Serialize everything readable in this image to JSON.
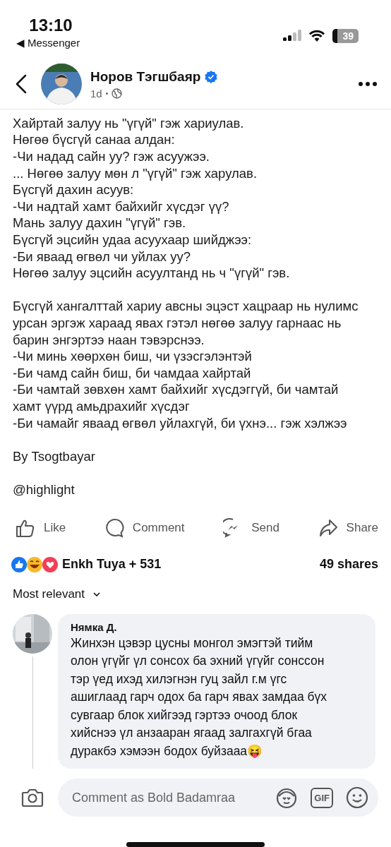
{
  "status_bar": {
    "time": "13:10",
    "back_app": "◀ Messenger",
    "battery": "39"
  },
  "post": {
    "author": "Норов Тэгшбаяр",
    "verified": true,
    "time": "1d",
    "paragraphs": [
      [
        "Хайртай залуу нь \"үгүй\" гэж хариулав.",
        "Нөгөө бүсгүй санаа алдан:",
        "-Чи надад сайн уу? гэж асуужээ.",
        "... Нөгөө залуу мөн л \"үгүй\" гэж харулав.",
        "Бүсгүй дахин асуув:",
        "-Чи надтай хамт байхийг хүсдэг үү?",
        "Мань залуу дахин \"үгүй\" гэв.",
        "Бүсгүй эцсийн удаа асуухаар шийджээ:",
        "-Би яваад өгвөл чи уйлах уу?",
        "Нөгөө залуу эцсийн асуултанд нь ч \"үгүй\" гэв."
      ],
      [
        "Бүсгүй хангалттай хариу авсны эцэст хацраар нь нулимс",
        "урсан эргэж хараад явах гэтэл нөгөө залуу гарнаас нь",
        "барин энгэртээ наан тэвэрснээ.",
        "-Чи минь хөөрхөн биш, чи үзэсгэлэнтэй",
        "-Би чамд сайн биш, би чамдаа хайртай",
        "-Би чамтай зөвхөн хамт байхийг хүсдэггүй, би чамтай",
        "хамт үүрд амьдрахийг хүсдэг",
        "-Би чамайг яваад өгвөл уйлахгүй, би үхнэ... гэж хэлжээ"
      ],
      [
        "By Tsogtbayar"
      ],
      [
        "@highlight"
      ]
    ]
  },
  "actions": [
    {
      "kind": "like",
      "label": "Like"
    },
    {
      "kind": "comment",
      "label": "Comment"
    },
    {
      "kind": "send",
      "label": "Send"
    },
    {
      "kind": "share",
      "label": "Share"
    }
  ],
  "reactions": {
    "summary": "Enkh Tuya + 531",
    "shares": "49 shares"
  },
  "sort": "Most relevant",
  "comment": {
    "author": "Нямка Д.",
    "lines": [
      "Жинхэн цэвэр цусны монгол эмэгтэй тийм",
      "олон үгүйг үл сонсох ба эхний үгүйг сонссон",
      "тэр үед ихэд хилэгнэн гуц зайл г.м үгс",
      "ашиглаад гарч одох ба гарч явах замдаа бүх",
      "сувгаар блок хийгээд гэртээ очоод блок",
      "хийснээ үл анзааран ягаад залгахгүй бгаа",
      "дуракбэ хэмээн бодох буйзааа😝"
    ]
  },
  "composer": {
    "placeholder": "Comment as Bold Badamraa",
    "gif": "GIF"
  }
}
